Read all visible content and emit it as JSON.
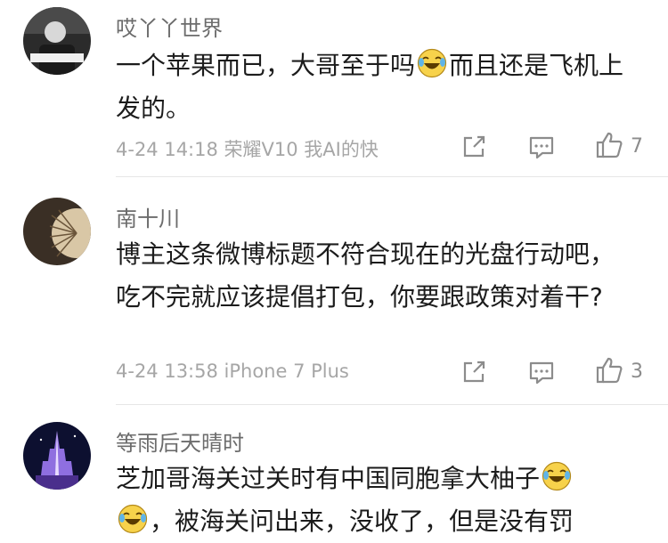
{
  "comments": [
    {
      "username": "哎丫丫世界",
      "text_before_emoji": "一个苹果而已，大哥至于吗",
      "text_after_emoji": "而且还是飞机上发的。",
      "emoji_icon": "laugh-cry-emoji-icon",
      "meta": "4-24 14:18  荣耀V10  我AI的快",
      "like_count": "7"
    },
    {
      "username": "南十川",
      "text": "博主这条微博标题不符合现在的光盘行动吧，吃不完就应该提倡打包，你要跟政策对着干?",
      "meta": "4-24 13:58  iPhone 7 Plus",
      "like_count": "3"
    },
    {
      "username": "等雨后天晴时",
      "text_before_emoji": "芝加哥海关过关时有中国同胞拿大柚子",
      "text_line2": "，被海关问出来，没收了，但是没有罚",
      "emoji_icon": "laugh-cry-emoji-icon"
    }
  ],
  "colors": {
    "username": "#6c6c6c",
    "text": "#1c1c1c",
    "meta": "#a6a6a6",
    "icon": "#8c8c8c",
    "divider": "#e6e6e6"
  }
}
